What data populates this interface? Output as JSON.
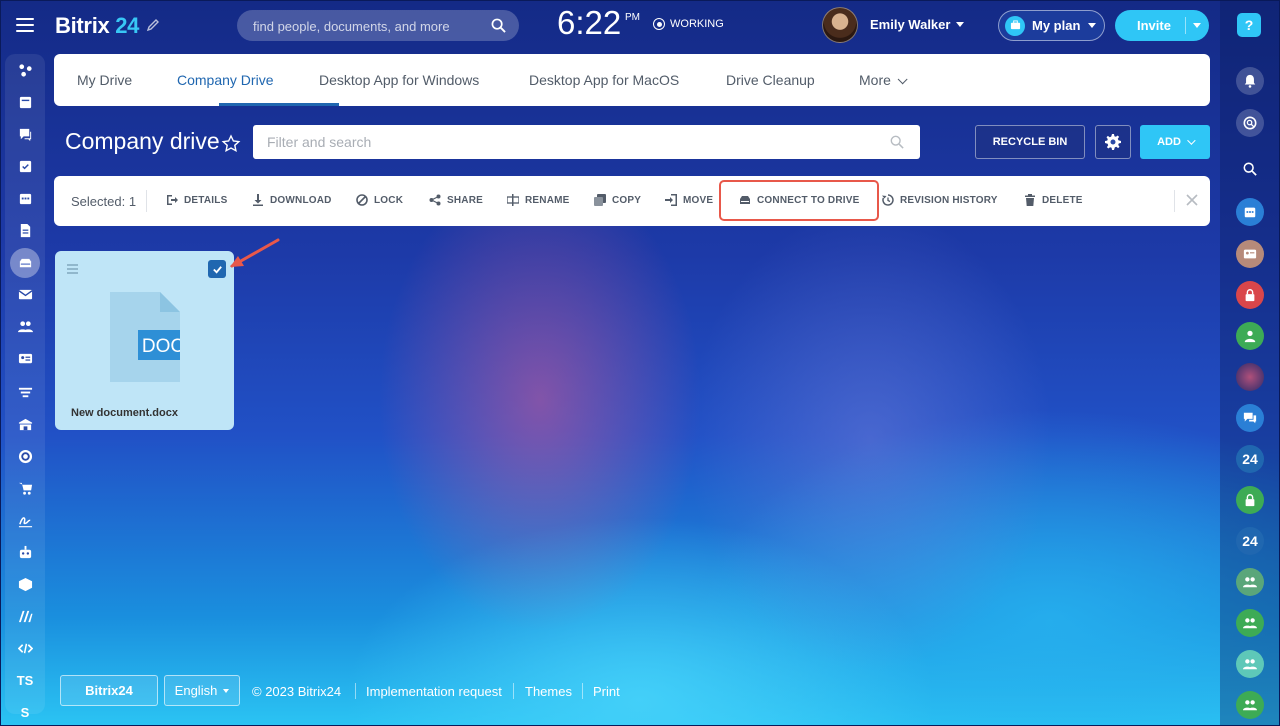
{
  "header": {
    "logo_main": "Bitrix",
    "logo_num": "24",
    "search_placeholder": "find people, documents, and more",
    "time": "6:22",
    "ampm": "PM",
    "work_status": "WORKING",
    "user_name": "Emily Walker",
    "plan_label": "My plan",
    "invite_label": "Invite"
  },
  "tabs": [
    {
      "label": "My Drive",
      "active": false
    },
    {
      "label": "Company Drive",
      "active": true
    },
    {
      "label": "Desktop App for Windows",
      "active": false
    },
    {
      "label": "Desktop App for MacOS",
      "active": false
    },
    {
      "label": "Drive Cleanup",
      "active": false
    },
    {
      "label": "More",
      "active": false
    }
  ],
  "page": {
    "title": "Company drive",
    "filter_placeholder": "Filter and search",
    "recycle_label": "RECYCLE BIN",
    "add_label": "ADD"
  },
  "action_bar": {
    "selected": "Selected: 1",
    "actions": [
      "DETAILS",
      "DOWNLOAD",
      "LOCK",
      "SHARE",
      "RENAME",
      "COPY",
      "MOVE",
      "CONNECT TO DRIVE",
      "REVISION HISTORY",
      "DELETE"
    ]
  },
  "file": {
    "type_label": "DOC",
    "name": "New document.docx",
    "checked": true
  },
  "left_menu": {
    "text_items": [
      "TS",
      "S"
    ]
  },
  "right_bar": {
    "help": "?",
    "badges": [
      "24",
      "24"
    ]
  },
  "footer": {
    "logo": "Bitrix24",
    "language": "English",
    "copyright": "© 2023 Bitrix24",
    "links": [
      "Implementation request",
      "Themes",
      "Print"
    ]
  },
  "colors": {
    "accent": "#2fc6f6",
    "active_tab": "#2067b0",
    "highlight": "#e8584a",
    "tile_bg": "#bfe5f7"
  }
}
